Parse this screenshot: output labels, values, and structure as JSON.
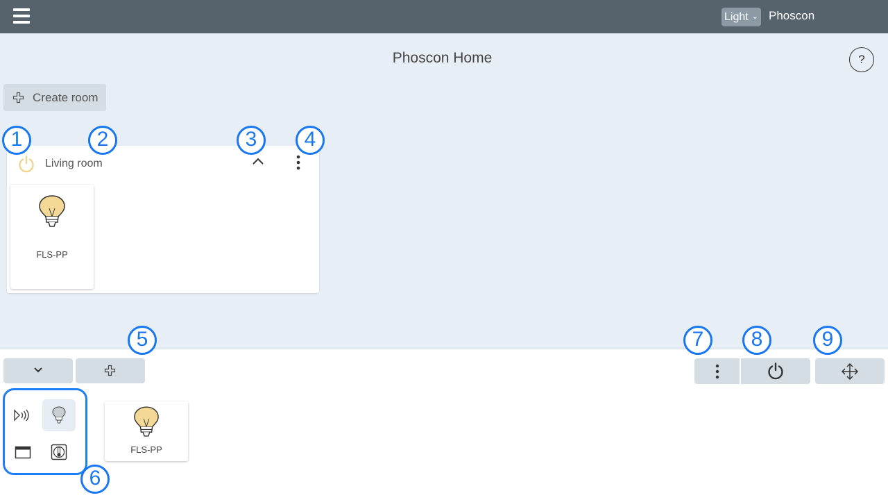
{
  "topbar": {
    "theme_select": {
      "value": "Light"
    },
    "brand": "Phoscon"
  },
  "main": {
    "title": "Phoscon Home",
    "help_label": "?",
    "create_room_label": "Create room",
    "room": {
      "name": "Living room",
      "devices": [
        {
          "name": "FLS-PP"
        }
      ]
    }
  },
  "bottom": {
    "unassigned_devices": [
      {
        "name": "FLS-PP"
      }
    ],
    "filters": [
      "sensor-icon",
      "light-bulb-icon",
      "window-covering-icon",
      "thermostat-icon"
    ]
  },
  "markers": [
    "1",
    "2",
    "3",
    "4",
    "5",
    "6",
    "7",
    "8",
    "9"
  ],
  "colors": {
    "topbar": "#56636d",
    "main_bg": "#e8eef5",
    "button_bg": "#d5dde4",
    "power_on": "#f0d48c",
    "marker": "#1877f2",
    "bulb_glass": "#f4d996"
  }
}
